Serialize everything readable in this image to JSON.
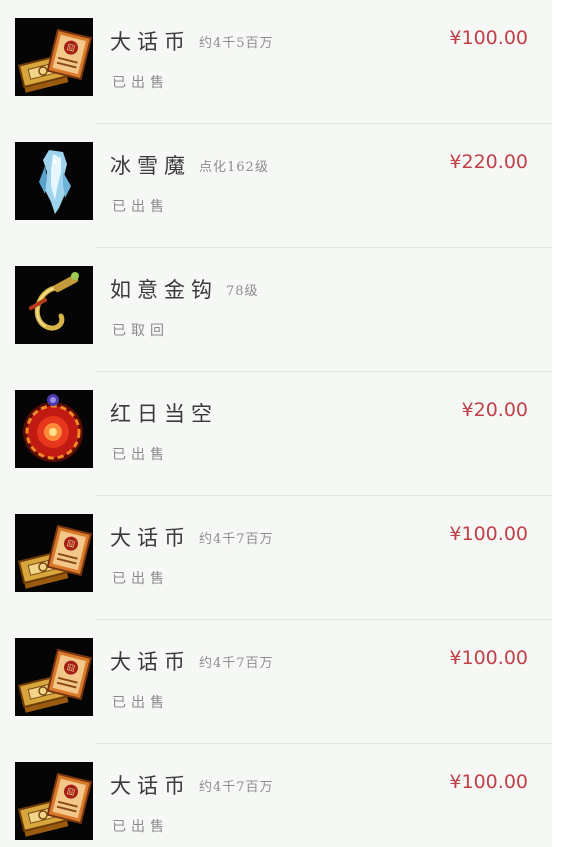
{
  "items": [
    {
      "name": "大话币",
      "note": "约4千5百万",
      "status": "已出售",
      "price": "¥100.00",
      "icon": "dahua-coin-icon"
    },
    {
      "name": "冰雪魔",
      "note": "点化162级",
      "status": "已出售",
      "price": "¥220.00",
      "icon": "ice-demon-icon"
    },
    {
      "name": "如意金钩",
      "note": "78级",
      "status": "已取回",
      "price": "",
      "icon": "golden-hook-icon"
    },
    {
      "name": "红日当空",
      "note": "",
      "status": "已出售",
      "price": "¥20.00",
      "icon": "red-sun-orb-icon"
    },
    {
      "name": "大话币",
      "note": "约4千7百万",
      "status": "已出售",
      "price": "¥100.00",
      "icon": "dahua-coin-icon"
    },
    {
      "name": "大话币",
      "note": "约4千7百万",
      "status": "已出售",
      "price": "¥100.00",
      "icon": "dahua-coin-icon"
    },
    {
      "name": "大话币",
      "note": "约4千7百万",
      "status": "已出售",
      "price": "¥100.00",
      "icon": "dahua-coin-icon"
    }
  ],
  "colors": {
    "price": "#c0414a",
    "background": "#f6f8f5"
  }
}
